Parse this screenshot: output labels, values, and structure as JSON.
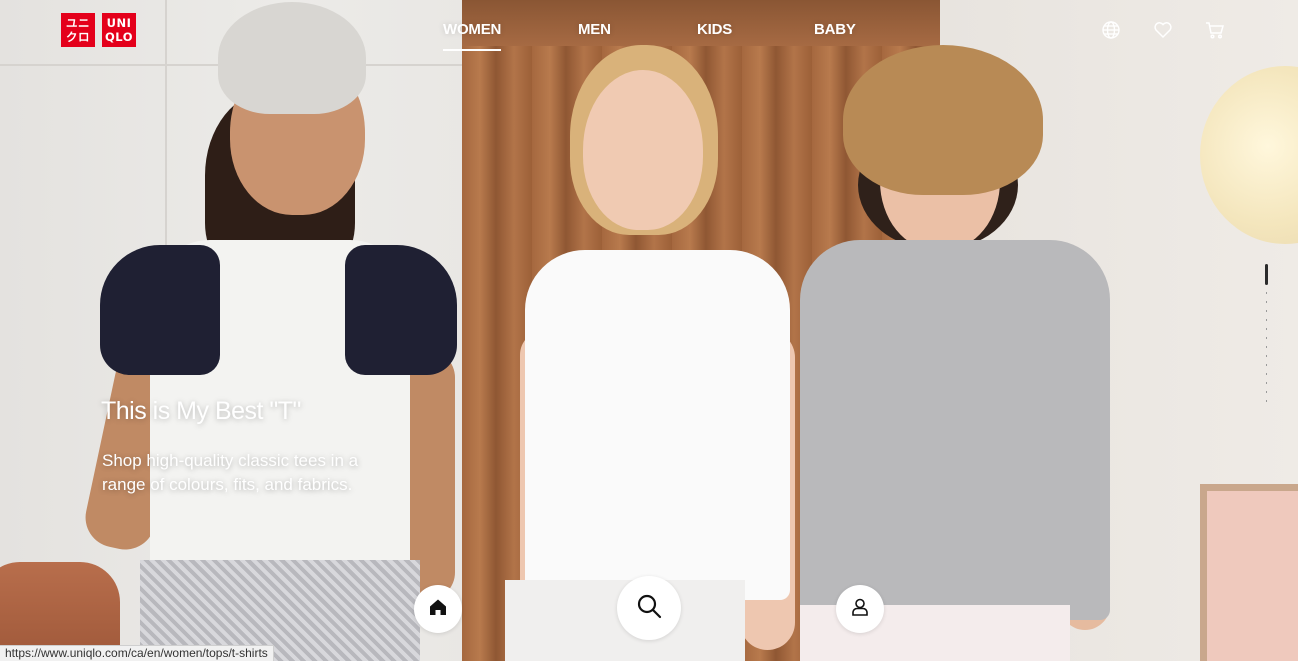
{
  "brand": {
    "logo_left": [
      "ユニ",
      "クロ"
    ],
    "logo_right": [
      "UNI",
      "QLO"
    ],
    "color": "#e4001b"
  },
  "nav": {
    "items": [
      {
        "label": "WOMEN",
        "active": true
      },
      {
        "label": "MEN",
        "active": false
      },
      {
        "label": "KIDS",
        "active": false
      },
      {
        "label": "BABY",
        "active": false
      }
    ]
  },
  "header_icons": [
    "globe-icon",
    "heart-icon",
    "cart-icon"
  ],
  "hero": {
    "title": "This is My Best \"T\"",
    "subtitle": "Shop high-quality classic tees in a range of colours, fits, and fabrics."
  },
  "bottom_bar": [
    "home-icon",
    "search-icon",
    "account-icon"
  ],
  "status_url": "https://www.uniqlo.com/ca/en/women/tops/t-shirts"
}
